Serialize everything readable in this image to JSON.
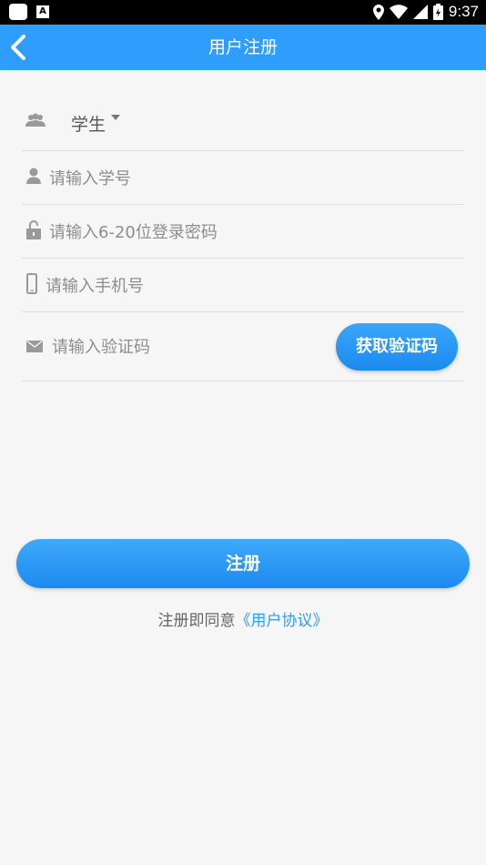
{
  "statusbar": {
    "time": "9:37"
  },
  "header": {
    "title": "用户注册"
  },
  "form": {
    "role_value": "学生",
    "student_id_placeholder": "请输入学号",
    "password_placeholder": "请输入6-20位登录密码",
    "phone_placeholder": "请输入手机号",
    "code_placeholder": "请输入验证码",
    "get_code_label": "获取验证码"
  },
  "actions": {
    "register_label": "注册"
  },
  "agreement": {
    "prefix": "注册即同意",
    "link": "《用户协议》"
  },
  "colors": {
    "primary": "#2f9dfb",
    "background": "#f6f6f6",
    "divider": "#dedede"
  }
}
